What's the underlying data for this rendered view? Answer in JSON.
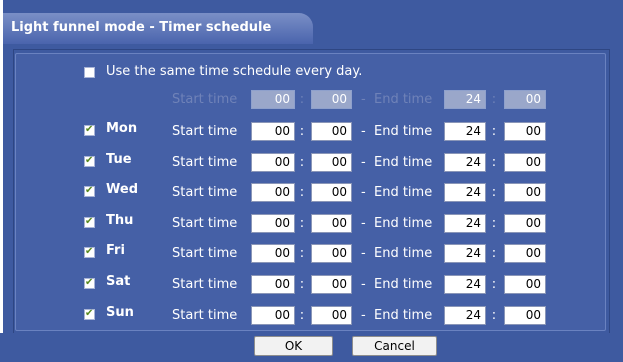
{
  "title": "Light funnel mode - Timer schedule",
  "same_schedule": {
    "label": "Use the same time schedule every day.",
    "checked": false
  },
  "common": {
    "start_label": "Start time",
    "start_hour": "00",
    "start_min": "00",
    "end_label": "End time",
    "end_hour": "24",
    "end_min": "00",
    "colon": ":",
    "dash": "-"
  },
  "days": [
    {
      "name": "Mon",
      "checked": true,
      "start_label": "Start time",
      "start_hour": "00",
      "start_min": "00",
      "end_label": "End time",
      "end_hour": "24",
      "end_min": "00"
    },
    {
      "name": "Tue",
      "checked": true,
      "start_label": "Start time",
      "start_hour": "00",
      "start_min": "00",
      "end_label": "End time",
      "end_hour": "24",
      "end_min": "00"
    },
    {
      "name": "Wed",
      "checked": true,
      "start_label": "Start time",
      "start_hour": "00",
      "start_min": "00",
      "end_label": "End time",
      "end_hour": "24",
      "end_min": "00"
    },
    {
      "name": "Thu",
      "checked": true,
      "start_label": "Start time",
      "start_hour": "00",
      "start_min": "00",
      "end_label": "End time",
      "end_hour": "24",
      "end_min": "00"
    },
    {
      "name": "Fri",
      "checked": true,
      "start_label": "Start time",
      "start_hour": "00",
      "start_min": "00",
      "end_label": "End time",
      "end_hour": "24",
      "end_min": "00"
    },
    {
      "name": "Sat",
      "checked": true,
      "start_label": "Start time",
      "start_hour": "00",
      "start_min": "00",
      "end_label": "End time",
      "end_hour": "24",
      "end_min": "00"
    },
    {
      "name": "Sun",
      "checked": true,
      "start_label": "Start time",
      "start_hour": "00",
      "start_min": "00",
      "end_label": "End time",
      "end_hour": "24",
      "end_min": "00"
    }
  ],
  "buttons": {
    "ok": "OK",
    "cancel": "Cancel"
  }
}
